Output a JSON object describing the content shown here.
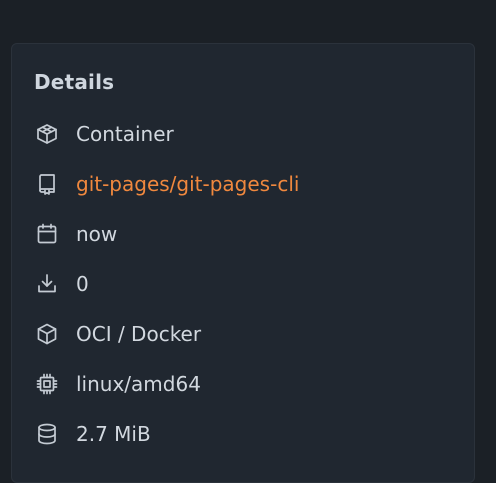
{
  "details": {
    "title": "Details",
    "rows": [
      {
        "icon": "container-box-icon",
        "label": "Container"
      },
      {
        "icon": "repo-icon",
        "label": "git-pages/git-pages-cli",
        "link_color": "#f0883e"
      },
      {
        "icon": "calendar-icon",
        "label": "now"
      },
      {
        "icon": "download-icon",
        "label": "0"
      },
      {
        "icon": "package-icon",
        "label": "OCI / Docker"
      },
      {
        "icon": "cpu-icon",
        "label": "linux/amd64"
      },
      {
        "icon": "database-icon",
        "label": "2.7 MiB"
      }
    ]
  }
}
